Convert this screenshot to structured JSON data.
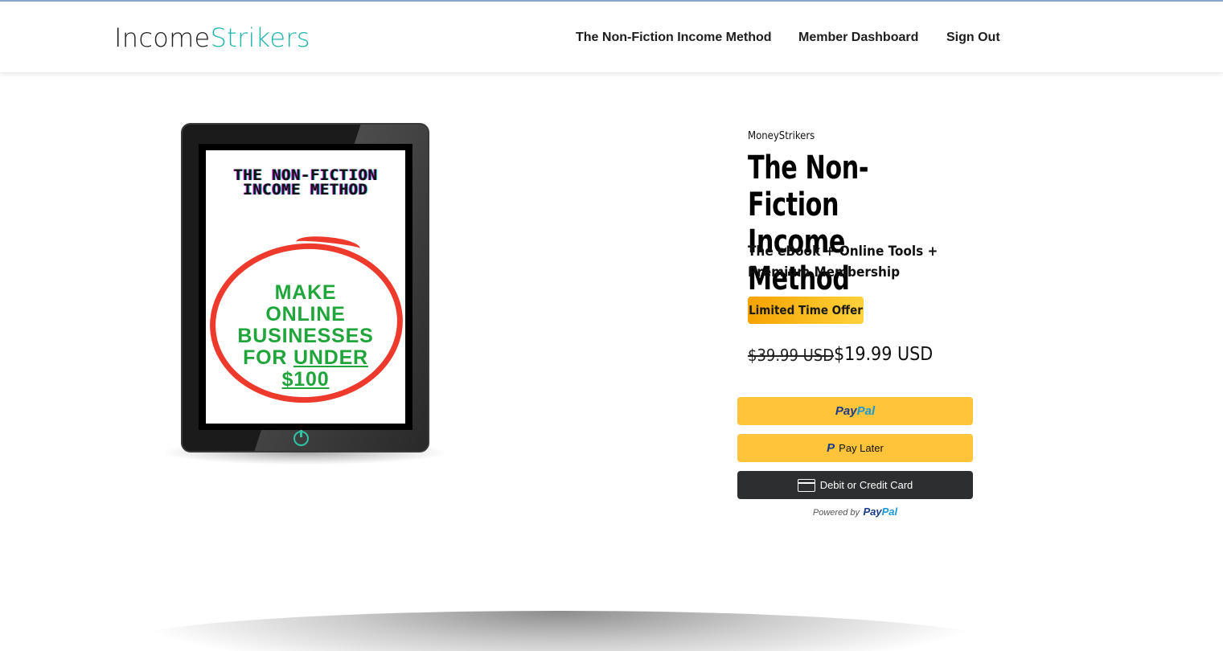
{
  "header": {
    "logo_part1": "Income",
    "logo_part2": "Strikers",
    "nav": [
      "The Non-Fiction Income Method",
      "Member Dashboard",
      "Sign Out"
    ]
  },
  "cover": {
    "title": "THE NON-FICTION INCOME METHOD",
    "text_line1": "MAKE",
    "text_line2": "ONLINE",
    "text_line3": "BUSINESSES",
    "text_line4_prefix": "FOR ",
    "text_line4_underline": "UNDER",
    "text_line5": "$100"
  },
  "product": {
    "brand": "MoneyStrikers",
    "title": "The Non-Fiction Income Method",
    "subtitle": "The eBook + Online Tools + Premium Membership",
    "badge": "Limited Time Offer",
    "price_old": "$39.99 USD",
    "price_new": "$19.99 USD"
  },
  "payment": {
    "paypal_p1": "Pay",
    "paypal_p2": "Pal",
    "paylater_icon": "P",
    "paylater_label": "Pay Later",
    "card_label": "Debit or Credit Card",
    "powered_by": "Powered by",
    "powered_p1": "Pay",
    "powered_p2": "Pal"
  },
  "colors": {
    "accent": "#1fb5ad",
    "paypal_yellow": "#ffc439",
    "badge_gradient_start": "#f5a300",
    "badge_gradient_end": "#ffd23b"
  },
  "icons": [
    "power-icon",
    "paypal-p-icon",
    "credit-card-icon"
  ]
}
